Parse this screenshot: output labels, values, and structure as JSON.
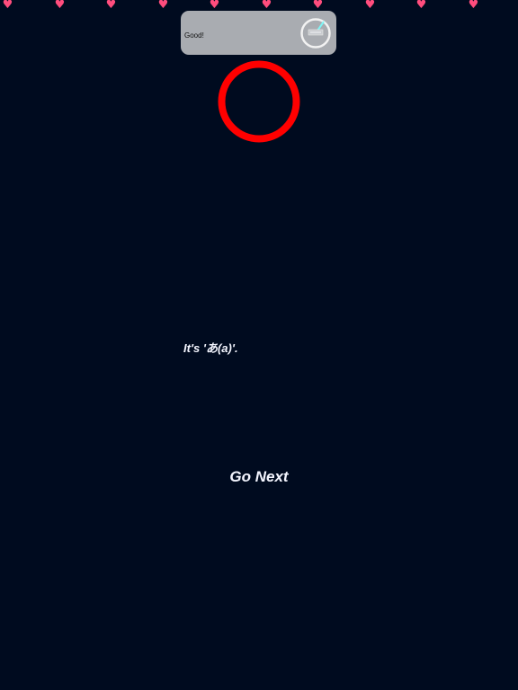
{
  "lives": {
    "icon": "heart-icon",
    "glyph": "♥",
    "color": "#ff4d7d",
    "count": 10
  },
  "toast": {
    "text": "Good!",
    "icon": "progress-dial-icon"
  },
  "target": {
    "icon": "red-ring-icon",
    "color": "#ff0000"
  },
  "answer": {
    "text": "It's 'あ(a)'."
  },
  "actions": {
    "go_next_label": "Go Next"
  },
  "colors": {
    "background": "#000b1f",
    "text": "#f4f6ff",
    "toast_bg": "#a9acb1"
  }
}
